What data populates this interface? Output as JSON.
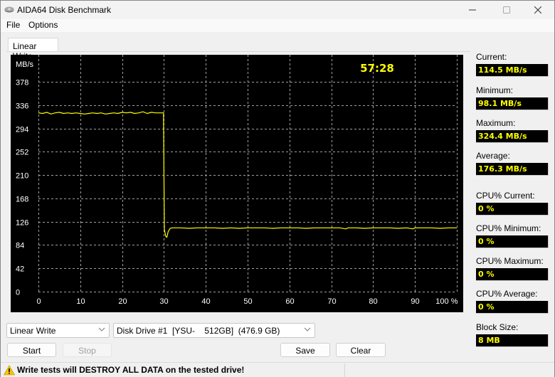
{
  "window": {
    "title": "AIDA64 Disk Benchmark",
    "controls": [
      "minimize",
      "maximize",
      "close"
    ]
  },
  "menu": {
    "items": [
      "File",
      "Options"
    ]
  },
  "tabs": [
    {
      "label": "Linear Write",
      "active": true
    }
  ],
  "chart": {
    "timer": "57:28",
    "line_color": "#ffff00",
    "background": "#000000"
  },
  "chart_data": {
    "type": "line",
    "title": "Linear Write",
    "ylabel": "MB/s",
    "xlabel": "%",
    "ylim": [
      0,
      378
    ],
    "xlim": [
      0,
      100
    ],
    "y_ticks": [
      0,
      42,
      84,
      126,
      168,
      210,
      252,
      294,
      336,
      378
    ],
    "x_ticks": [
      0,
      10,
      20,
      30,
      40,
      50,
      60,
      70,
      80,
      90,
      100
    ],
    "x_tick_labels": [
      "0",
      "10",
      "20",
      "30",
      "40",
      "50",
      "60",
      "70",
      "80",
      "90",
      "100 %"
    ],
    "grid": true,
    "series": [
      {
        "name": "Linear Write",
        "color": "#ffff00",
        "x": [
          0,
          1,
          2,
          3,
          4,
          5,
          6,
          7,
          8,
          9,
          10,
          11,
          12,
          13,
          14,
          15,
          16,
          17,
          18,
          19,
          20,
          21,
          22,
          23,
          24,
          25,
          26,
          27,
          28,
          29,
          29.9,
          30.1,
          30.4,
          30.7,
          31.0,
          31.5,
          32,
          34,
          36,
          38,
          40,
          42,
          44,
          46,
          48,
          50,
          52,
          54,
          56,
          58,
          60,
          62,
          64,
          66,
          68,
          70,
          72,
          73.5,
          74,
          76,
          78,
          80,
          82,
          84,
          86,
          88,
          89.5,
          90,
          92,
          94,
          96,
          98,
          100
        ],
        "values": [
          322,
          321,
          323,
          320,
          322,
          323,
          321,
          322,
          321,
          322,
          321,
          320,
          321,
          322,
          321,
          322,
          320,
          321,
          322,
          321,
          323,
          322,
          323,
          321,
          322,
          324,
          321,
          323,
          322,
          322,
          322,
          112,
          100,
          98,
          108,
          114,
          115,
          115,
          114,
          115,
          115,
          115,
          114,
          115,
          114,
          115,
          115,
          115,
          114,
          115,
          115,
          115,
          114,
          115,
          115,
          115,
          115,
          113,
          115,
          115,
          114,
          115,
          115,
          115,
          114,
          115,
          113,
          115,
          115,
          115,
          114,
          115,
          115
        ]
      }
    ]
  },
  "stats": [
    {
      "label": "Current:",
      "value": "114.5 MB/s"
    },
    {
      "label": "Minimum:",
      "value": "98.1 MB/s"
    },
    {
      "label": "Maximum:",
      "value": "324.4 MB/s"
    },
    {
      "label": "Average:",
      "value": "176.3 MB/s"
    },
    {
      "label": "CPU% Current:",
      "value": "0 %"
    },
    {
      "label": "CPU% Minimum:",
      "value": "0 %"
    },
    {
      "label": "CPU% Maximum:",
      "value": "0 %"
    },
    {
      "label": "CPU% Average:",
      "value": "0 %"
    },
    {
      "label": "Block Size:",
      "value": "8 MB"
    }
  ],
  "controls": {
    "test_select": "Linear Write",
    "drive_select": "Disk Drive #1  [YSU-    512GB]  (476.9 GB)",
    "start_label": "Start",
    "stop_label": "Stop",
    "save_label": "Save",
    "clear_label": "Clear"
  },
  "status": {
    "warning": "Write tests will DESTROY ALL DATA on the tested drive!"
  }
}
